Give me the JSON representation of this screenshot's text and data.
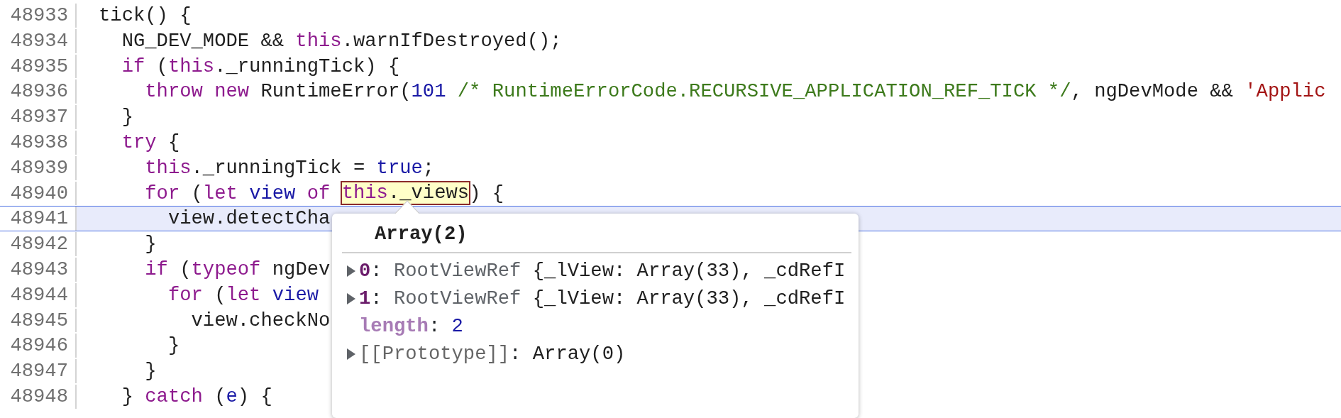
{
  "editor": {
    "lines": [
      {
        "number": "48933",
        "current": false,
        "tokens": [
          {
            "kind": "plain",
            "text": "tick() {"
          }
        ]
      },
      {
        "number": "48934",
        "current": false,
        "tokens": [
          {
            "kind": "plain",
            "text": "  NG_DEV_MODE && "
          },
          {
            "kind": "keyword",
            "text": "this"
          },
          {
            "kind": "plain",
            "text": ".warnIfDestroyed();"
          }
        ]
      },
      {
        "number": "48935",
        "current": false,
        "tokens": [
          {
            "kind": "keyword",
            "text": "  if"
          },
          {
            "kind": "plain",
            "text": " ("
          },
          {
            "kind": "keyword",
            "text": "this"
          },
          {
            "kind": "plain",
            "text": "._runningTick) {"
          }
        ]
      },
      {
        "number": "48936",
        "current": false,
        "tokens": [
          {
            "kind": "keyword",
            "text": "    throw new"
          },
          {
            "kind": "plain",
            "text": " RuntimeError("
          },
          {
            "kind": "number",
            "text": "101"
          },
          {
            "kind": "comment",
            "text": " /* RuntimeErrorCode.RECURSIVE_APPLICATION_REF_TICK */"
          },
          {
            "kind": "plain",
            "text": ", ngDevMode && "
          },
          {
            "kind": "string",
            "text": "'Applic"
          }
        ]
      },
      {
        "number": "48937",
        "current": false,
        "tokens": [
          {
            "kind": "plain",
            "text": "  }"
          }
        ]
      },
      {
        "number": "48938",
        "current": false,
        "tokens": [
          {
            "kind": "keyword",
            "text": "  try"
          },
          {
            "kind": "plain",
            "text": " {"
          }
        ]
      },
      {
        "number": "48939",
        "current": false,
        "tokens": [
          {
            "kind": "keyword",
            "text": "    this"
          },
          {
            "kind": "plain",
            "text": "._runningTick = "
          },
          {
            "kind": "def",
            "text": "true"
          },
          {
            "kind": "plain",
            "text": ";"
          }
        ]
      },
      {
        "number": "48940",
        "current": false,
        "tokens": [
          {
            "kind": "keyword",
            "text": "    for"
          },
          {
            "kind": "plain",
            "text": " ("
          },
          {
            "kind": "keyword",
            "text": "let"
          },
          {
            "kind": "def",
            "text": " view"
          },
          {
            "kind": "keyword",
            "text": " of "
          },
          {
            "kind": "hover",
            "tokens": [
              {
                "kind": "keyword",
                "text": "this"
              },
              {
                "kind": "plain",
                "text": "._views"
              }
            ]
          },
          {
            "kind": "plain",
            "text": ") {"
          }
        ]
      },
      {
        "number": "48941",
        "current": true,
        "tokens": [
          {
            "kind": "plain",
            "text": "      view.detectCha"
          }
        ]
      },
      {
        "number": "48942",
        "current": false,
        "tokens": [
          {
            "kind": "plain",
            "text": "    }"
          }
        ]
      },
      {
        "number": "48943",
        "current": false,
        "tokens": [
          {
            "kind": "keyword",
            "text": "    if"
          },
          {
            "kind": "plain",
            "text": " ("
          },
          {
            "kind": "keyword",
            "text": "typeof"
          },
          {
            "kind": "plain",
            "text": " ngDev"
          }
        ]
      },
      {
        "number": "48944",
        "current": false,
        "tokens": [
          {
            "kind": "keyword",
            "text": "      for"
          },
          {
            "kind": "plain",
            "text": " ("
          },
          {
            "kind": "keyword",
            "text": "let"
          },
          {
            "kind": "def",
            "text": " view"
          }
        ]
      },
      {
        "number": "48945",
        "current": false,
        "tokens": [
          {
            "kind": "plain",
            "text": "        view.checkNo"
          }
        ]
      },
      {
        "number": "48946",
        "current": false,
        "tokens": [
          {
            "kind": "plain",
            "text": "      }"
          }
        ]
      },
      {
        "number": "48947",
        "current": false,
        "tokens": [
          {
            "kind": "plain",
            "text": "    }"
          }
        ]
      },
      {
        "number": "48948",
        "current": false,
        "tokens": [
          {
            "kind": "plain",
            "text": "  } "
          },
          {
            "kind": "keyword",
            "text": "catch"
          },
          {
            "kind": "plain",
            "text": " ("
          },
          {
            "kind": "def",
            "text": "e"
          },
          {
            "kind": "plain",
            "text": ") {"
          }
        ]
      }
    ]
  },
  "popup": {
    "title": "Array(2)",
    "rows": [
      {
        "kind": "index",
        "expandable": true,
        "key": "0",
        "separator": ": ",
        "class_name": "RootViewRef ",
        "value": "{_lView: Array(33), _cdRefI"
      },
      {
        "kind": "index",
        "expandable": true,
        "key": "1",
        "separator": ": ",
        "class_name": "RootViewRef ",
        "value": "{_lView: Array(33), _cdRefI"
      },
      {
        "kind": "property",
        "expandable": false,
        "key": "length",
        "separator": ": ",
        "value": "2"
      },
      {
        "kind": "internal",
        "expandable": true,
        "key": "[[Prototype]]",
        "separator": ": ",
        "value": "Array(0)"
      }
    ]
  }
}
